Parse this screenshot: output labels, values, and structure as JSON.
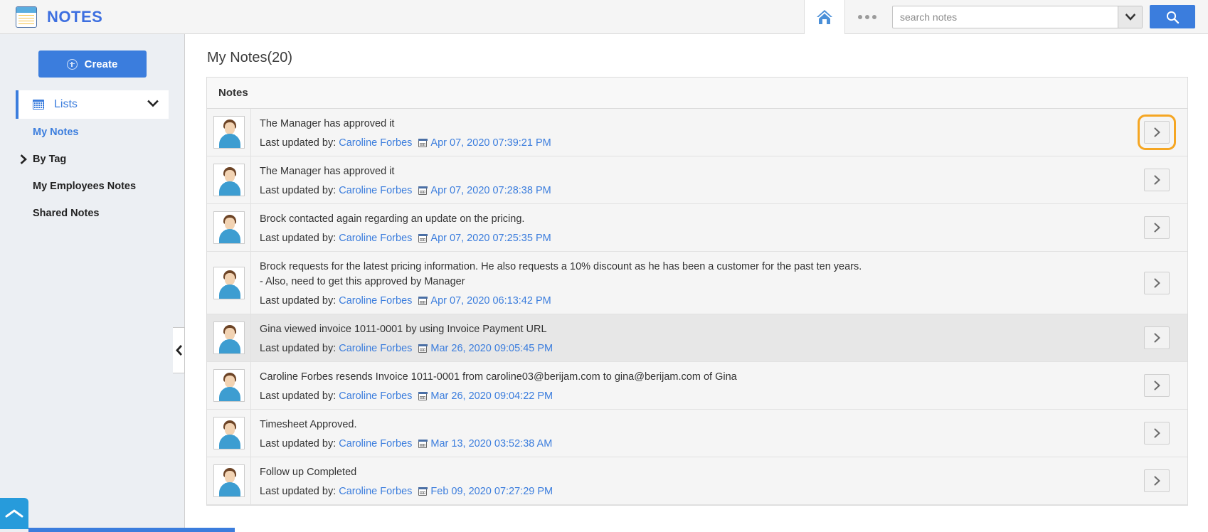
{
  "app": {
    "brand": "NOTES",
    "brand_color": "#3d6fe0",
    "accent_color": "#3b7ddd",
    "focus_highlight_color": "#f5a623"
  },
  "topbar": {
    "home_icon": "home-icon",
    "more_icon": "more-dots-icon",
    "search_placeholder": "search notes",
    "search_value": "",
    "dropdown_icon": "chevron-down-icon",
    "search_icon": "search-icon"
  },
  "sidebar": {
    "create_label": "Create",
    "create_icon": "plus-circle-icon",
    "lists": {
      "label": "Lists",
      "icon": "grid-icon",
      "chevron": "chevron-down-icon"
    },
    "items": [
      {
        "label": "My Notes",
        "active": true,
        "has_arrow": false
      },
      {
        "label": "By Tag",
        "active": false,
        "has_arrow": true
      },
      {
        "label": "My Employees Notes",
        "active": false,
        "has_arrow": false
      },
      {
        "label": "Shared Notes",
        "active": false,
        "has_arrow": false
      }
    ],
    "collapse_icon": "chevron-left-icon",
    "scroll_top_icon": "chevron-up-icon"
  },
  "main": {
    "page_title": "My Notes(20)",
    "panel_header": "Notes",
    "meta_prefix": "Last updated by:",
    "rows": [
      {
        "text": "The Manager has approved it",
        "author": "Caroline Forbes",
        "date": "Apr 07, 2020 07:39:21 PM",
        "focused": true,
        "alt": false
      },
      {
        "text": "The Manager has approved it",
        "author": "Caroline Forbes",
        "date": "Apr 07, 2020 07:28:38 PM",
        "focused": false,
        "alt": false
      },
      {
        "text": "Brock contacted again regarding an update on the pricing.",
        "author": "Caroline Forbes",
        "date": "Apr 07, 2020 07:25:35 PM",
        "focused": false,
        "alt": false
      },
      {
        "text": "Brock requests for the latest pricing information. He also requests a 10% discount as he has been a customer for the past ten years.\n- Also, need to get this approved by Manager",
        "author": "Caroline Forbes",
        "date": "Apr 07, 2020 06:13:42 PM",
        "focused": false,
        "alt": false,
        "tall": true
      },
      {
        "text": "Gina viewed invoice 1011-0001 by using Invoice Payment URL",
        "author": "Caroline Forbes",
        "date": "Mar 26, 2020 09:05:45 PM",
        "focused": false,
        "alt": true
      },
      {
        "text": "Caroline Forbes resends Invoice 1011-0001 from caroline03@berijam.com to gina@berijam.com of Gina",
        "author": "Caroline Forbes",
        "date": "Mar 26, 2020 09:04:22 PM",
        "focused": false,
        "alt": false
      },
      {
        "text": "Timesheet Approved.",
        "author": "Caroline Forbes",
        "date": "Mar 13, 2020 03:52:38 AM",
        "focused": false,
        "alt": false
      },
      {
        "text": "Follow up Completed",
        "author": "Caroline Forbes",
        "date": "Feb 09, 2020 07:27:29 PM",
        "focused": false,
        "alt": false
      }
    ],
    "row_chevron_icon": "chevron-right-icon",
    "avatar_icon": "user-avatar-icon"
  }
}
